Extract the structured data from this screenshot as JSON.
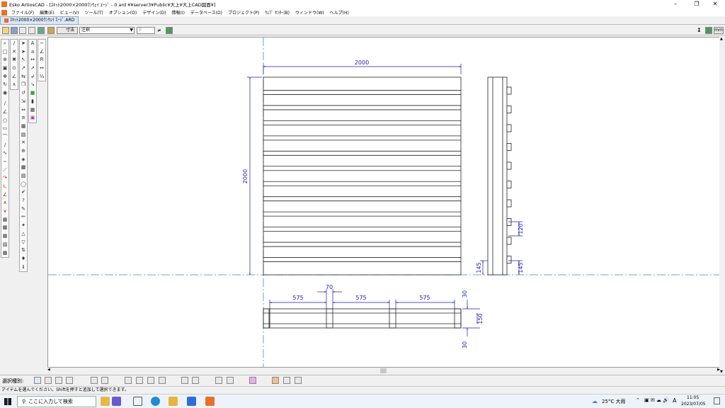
{
  "window": {
    "title": "Esko ArtiosCAD - [ｽｷｯﾄ2000×2000ﾜﾝｳｪｲ ｴｰｼﾞ - 0 ard ¥¥server3¥Public¥大上¥大上CAD図面¥]"
  },
  "menu": [
    "ファイル(F)",
    "編集(E)",
    "ビュー(V)",
    "ツール(T)",
    "オプション(O)",
    "デザイン(D)",
    "情報(I)",
    "データベース(D)",
    "プロジェクト(P)",
    "ｳｪﾌﾞ ｾﾝﾀｰ(B)",
    "ウィンドウ(W)",
    "ヘルプ(H)"
  ],
  "document_tab": "ｽｷｯﾄ2000×2000ﾜﾝｳｪｲ ｴｰｼﾞ.ARD",
  "toolbar": {
    "dim_label": "寸法",
    "layer_value": "注釈",
    "zero_value": "0",
    "mm_label": "mm"
  },
  "drawing": {
    "width_dim": "2000",
    "height_dim": "2000",
    "bottom_dims": [
      "575",
      "70",
      "575",
      "575"
    ],
    "side_dims": [
      "30",
      "150",
      "30"
    ],
    "right_dims": [
      "120",
      "145",
      "145"
    ]
  },
  "selection_bar": {
    "label": "選択種別:"
  },
  "status": {
    "message": "アイテムを選んでください。Shiftを押すと追加して選択できます。"
  },
  "taskbar": {
    "search_placeholder": "ここに入力して検索",
    "weather": "25°C 大雨",
    "time": "11:05",
    "date": "2023/07/05",
    "ime": "A"
  },
  "colors": {
    "dimension": "#1b1bb3",
    "centerline": "#3a8fbf"
  }
}
